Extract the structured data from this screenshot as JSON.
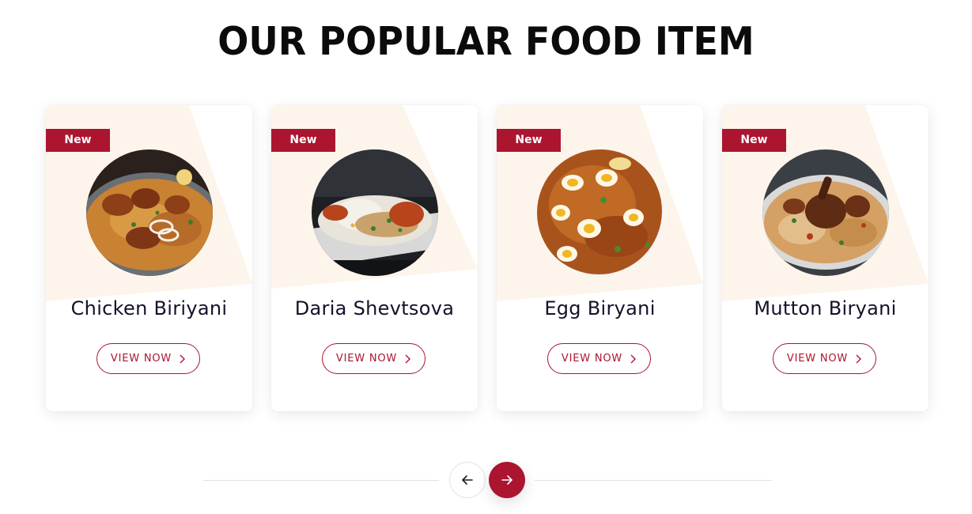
{
  "section": {
    "title": "OUR POPULAR FOOD ITEM"
  },
  "colors": {
    "accent": "#ab1530",
    "card_shape": "#fdf5eb",
    "title": "#0b0b0b",
    "food_name": "#12122a"
  },
  "cards": [
    {
      "badge": "New",
      "name": "Chicken Biriyani",
      "button_label": "VIEW NOW",
      "button_icon": "chevron-right-icon",
      "image": "chicken-biriyani-photo"
    },
    {
      "badge": "New",
      "name": "Daria Shevtsova",
      "button_label": "VIEW NOW",
      "button_icon": "chevron-right-icon",
      "image": "chicken-leg-rice-platter-photo"
    },
    {
      "badge": "New",
      "name": "Egg Biryani",
      "button_label": "VIEW NOW",
      "button_icon": "chevron-right-icon",
      "image": "egg-biryani-photo"
    },
    {
      "badge": "New",
      "name": "Mutton Biryani",
      "button_label": "VIEW NOW",
      "button_icon": "chevron-right-icon",
      "image": "mutton-biryani-photo"
    }
  ],
  "slider": {
    "prev_icon": "arrow-left-icon",
    "next_icon": "arrow-right-icon",
    "active": "next"
  }
}
